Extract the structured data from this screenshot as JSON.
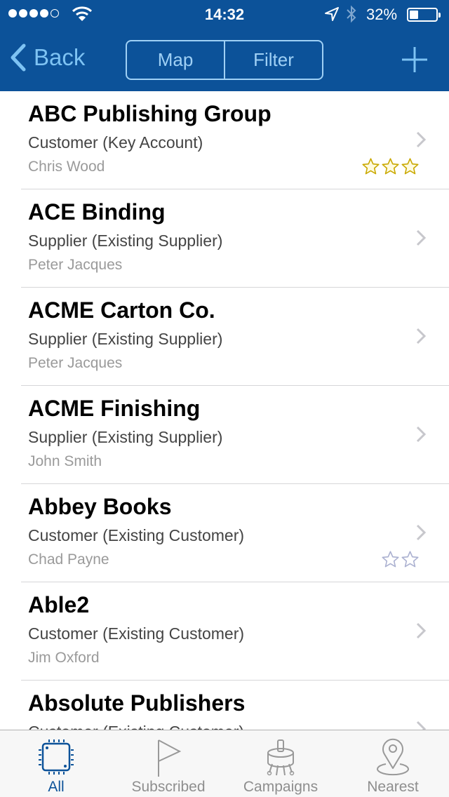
{
  "status_bar": {
    "signal_bars_filled": 4,
    "signal_bars_total": 5,
    "time": "14:32",
    "battery_percent_label": "32%",
    "battery_level": 0.32,
    "icons": [
      "signal-dots",
      "wifi-icon",
      "location-arrow-icon",
      "bluetooth-icon",
      "battery-icon"
    ]
  },
  "nav_bar": {
    "back_label": "Back",
    "segments": [
      {
        "label": "Map"
      },
      {
        "label": "Filter"
      }
    ],
    "add_icon": "plus-icon",
    "background_color": "#0c5299",
    "tint_color": "#7ec3f3"
  },
  "list": {
    "items": [
      {
        "name": "ABC Publishing Group",
        "type": "Customer (Key Account)",
        "contact": "Chris Wood",
        "stars": 3,
        "star_style": "gold"
      },
      {
        "name": "ACE Binding",
        "type": "Supplier (Existing Supplier)",
        "contact": "Peter Jacques",
        "stars": 0,
        "star_style": ""
      },
      {
        "name": "ACME Carton Co.",
        "type": "Supplier (Existing Supplier)",
        "contact": "Peter Jacques",
        "stars": 0,
        "star_style": ""
      },
      {
        "name": "ACME Finishing",
        "type": "Supplier (Existing Supplier)",
        "contact": "John Smith",
        "stars": 0,
        "star_style": ""
      },
      {
        "name": "Abbey Books",
        "type": "Customer (Existing Customer)",
        "contact": "Chad Payne",
        "stars": 2,
        "star_style": "silver"
      },
      {
        "name": "Able2",
        "type": "Customer (Existing Customer)",
        "contact": "Jim Oxford",
        "stars": 0,
        "star_style": ""
      },
      {
        "name": "Absolute Publishers",
        "type": "Customer (Existing Customer)",
        "contact": "",
        "stars": 0,
        "star_style": ""
      }
    ]
  },
  "tab_bar": {
    "tabs": [
      {
        "label": "All",
        "icon": "chip-icon",
        "active": true
      },
      {
        "label": "Subscribed",
        "icon": "flag-icon",
        "active": false
      },
      {
        "label": "Campaigns",
        "icon": "campaigns-icon",
        "active": false
      },
      {
        "label": "Nearest",
        "icon": "map-pin-icon",
        "active": false
      }
    ],
    "active_color": "#0c5299",
    "inactive_color": "#8e8e8e"
  }
}
